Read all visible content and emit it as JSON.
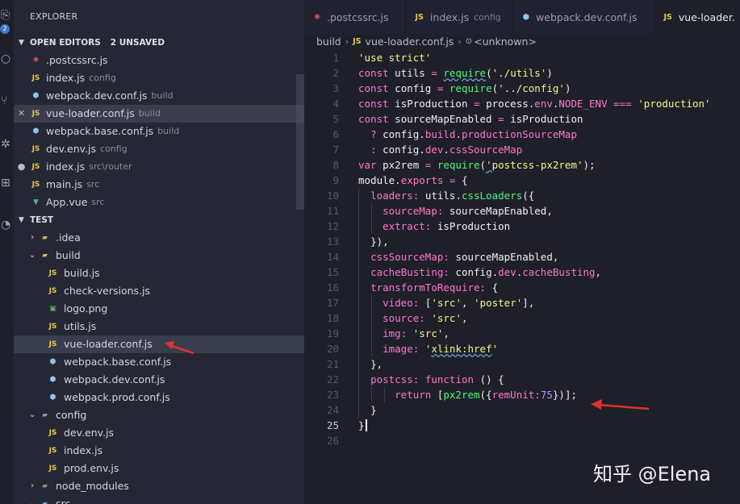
{
  "tabs": [
    {
      "icon": "postcss-icon",
      "name": ".postcssrc.js",
      "desc": "",
      "active": false
    },
    {
      "icon": "js-icon",
      "name": "index.js",
      "desc": "config",
      "active": false
    },
    {
      "icon": "webpack-icon",
      "name": "webpack.dev.conf.js",
      "desc": "",
      "active": false
    },
    {
      "icon": "js-icon",
      "name": "vue-loader.",
      "desc": "",
      "active": true
    }
  ],
  "activity": {
    "badge": "2"
  },
  "explorer": {
    "title": "EXPLORER",
    "open_editors": {
      "label": "OPEN EDITORS",
      "unsaved": "2 UNSAVED",
      "items": [
        {
          "icon": "postcss-icon",
          "badge": "",
          "name": ".postcssrc.js",
          "desc": ""
        },
        {
          "icon": "js-icon",
          "badge": "JS",
          "name": "index.js",
          "desc": "config"
        },
        {
          "icon": "webpack-icon",
          "badge": "",
          "name": "webpack.dev.conf.js",
          "desc": "build"
        },
        {
          "icon": "js-icon",
          "badge": "JS",
          "name": "vue-loader.conf.js",
          "desc": "build",
          "gutter": "✕",
          "selected": true
        },
        {
          "icon": "webpack-icon",
          "badge": "",
          "name": "webpack.base.conf.js",
          "desc": "build"
        },
        {
          "icon": "js-icon",
          "badge": "JS",
          "name": "dev.env.js",
          "desc": "config"
        },
        {
          "icon": "js-icon",
          "badge": "JS",
          "name": "index.js",
          "desc": "src\\router",
          "gutter": "●"
        },
        {
          "icon": "js-icon",
          "badge": "JS",
          "name": "main.js",
          "desc": "src"
        },
        {
          "icon": "vue-icon",
          "badge": "",
          "name": "App.vue",
          "desc": "src"
        }
      ]
    },
    "project": {
      "label": "TEST",
      "tree": [
        {
          "depth": 0,
          "chev": "›",
          "icon": "folder-icon",
          "name": ".idea"
        },
        {
          "depth": 0,
          "chev": "⌄",
          "icon": "folder-open-icon",
          "name": "build"
        },
        {
          "depth": 1,
          "icon": "js-icon",
          "badge": "JS",
          "name": "build.js"
        },
        {
          "depth": 1,
          "icon": "js-icon",
          "badge": "JS",
          "name": "check-versions.js"
        },
        {
          "depth": 1,
          "icon": "image-icon",
          "badge": "",
          "name": "logo.png"
        },
        {
          "depth": 1,
          "icon": "js-icon",
          "badge": "JS",
          "name": "utils.js"
        },
        {
          "depth": 1,
          "icon": "js-icon",
          "badge": "JS",
          "name": "vue-loader.conf.js",
          "selected": true
        },
        {
          "depth": 1,
          "icon": "webpack-icon",
          "badge": "",
          "name": "webpack.base.conf.js"
        },
        {
          "depth": 1,
          "icon": "webpack-icon",
          "badge": "",
          "name": "webpack.dev.conf.js"
        },
        {
          "depth": 1,
          "icon": "webpack-icon",
          "badge": "",
          "name": "webpack.prod.conf.js"
        },
        {
          "depth": 0,
          "chev": "⌄",
          "icon": "folder-config-icon",
          "name": "config"
        },
        {
          "depth": 1,
          "icon": "js-icon",
          "badge": "JS",
          "name": "dev.env.js"
        },
        {
          "depth": 1,
          "icon": "js-icon",
          "badge": "JS",
          "name": "index.js"
        },
        {
          "depth": 1,
          "icon": "js-icon",
          "badge": "JS",
          "name": "prod.env.js"
        },
        {
          "depth": 0,
          "chev": "›",
          "icon": "folder-node-icon",
          "name": "node_modules"
        },
        {
          "depth": 0,
          "chev": "⌄",
          "icon": "folder-src-icon",
          "name": "src"
        }
      ]
    }
  },
  "breadcrumb": {
    "folder": "build",
    "file_badge": "JS",
    "file": "vue-loader.conf.js",
    "symbol_icon": "⊙",
    "symbol": "<unknown>"
  },
  "code": {
    "current_line": 25,
    "lines": [
      "'use strict'",
      "const utils = require('./utils')",
      "const config = require('../config')",
      "const isProduction = process.env.NODE_ENV === 'production'",
      "const sourceMapEnabled = isProduction",
      "  ? config.build.productionSourceMap",
      "  : config.dev.cssSourceMap",
      "var px2rem = require('postcss-px2rem');",
      "module.exports = {",
      "  loaders: utils.cssLoaders({",
      "    sourceMap: sourceMapEnabled,",
      "    extract: isProduction",
      "  }),",
      "  cssSourceMap: sourceMapEnabled,",
      "  cacheBusting: config.dev.cacheBusting,",
      "  transformToRequire: {",
      "    video: ['src', 'poster'],",
      "    source: 'src',",
      "    img: 'src',",
      "    image: 'xlink:href'",
      "  },",
      "  postcss: function () {",
      "      return [px2rem({remUnit:75})];",
      "  }",
      "}",
      ""
    ]
  },
  "watermark": "知乎 @Elena",
  "colors": {
    "accent_arrow": "#e0332b",
    "keyword": "#ff79c6",
    "string": "#f1fa8c",
    "function": "#50fa7b",
    "number": "#bd93f9"
  }
}
